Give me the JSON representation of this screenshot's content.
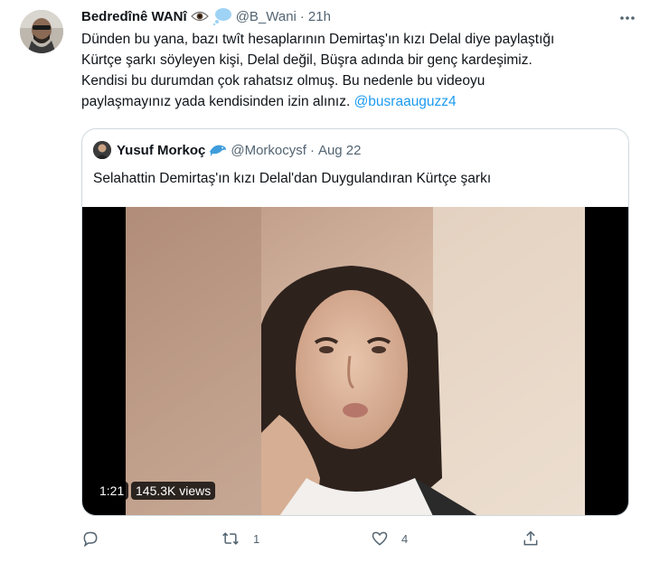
{
  "tweet": {
    "author_name": "Bedredînê WANî",
    "author_emojis": [
      "eye-icon",
      "thought-bubble-icon"
    ],
    "handle": "@B_Wani",
    "separator": "·",
    "time": "21h",
    "text_lines": [
      "Dünden bu yana, bazı twît hesaplarının Demirtaş'ın kızı Delal diye paylaştığı",
      "Kürtçe şarkı söyleyen kişi, Delal değil, Büşra adında bir genç kardeşimiz.",
      "Kendisi bu durumdan çok rahatsız olmuş. Bu nedenle bu videoyu",
      "paylaşmayınız yada kendisinden izin alınız. "
    ],
    "mention": "@busraauguzz4"
  },
  "quoted": {
    "author_name": "Yusuf Morkoç",
    "author_emoji": "dolphin-icon",
    "handle": "@Morkocysf",
    "separator": "·",
    "date": "Aug 22",
    "text": "Selahattin Demirtaş'ın kızı Delal'dan  Duygulandıran Kürtçe şarkı",
    "video": {
      "duration": "1:21",
      "views": "145.3K views"
    }
  },
  "actions": {
    "reply_count": "",
    "retweet_count": "1",
    "like_count": "4",
    "share_label": ""
  },
  "colors": {
    "text": "#0f1419",
    "secondary": "#536471",
    "accent": "#1d9bf0",
    "border": "#cfd9de"
  }
}
